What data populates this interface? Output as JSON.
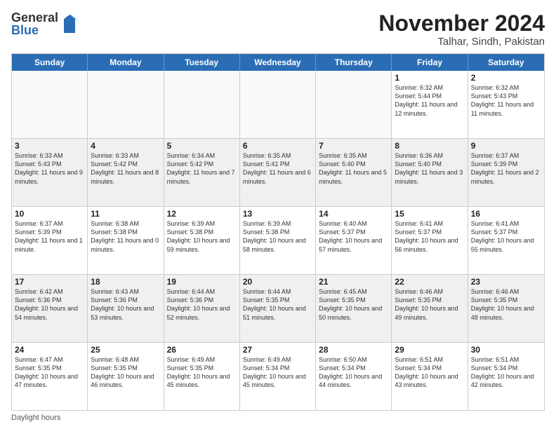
{
  "logo": {
    "general": "General",
    "blue": "Blue"
  },
  "title": {
    "month": "November 2024",
    "location": "Talhar, Sindh, Pakistan"
  },
  "header_days": [
    "Sunday",
    "Monday",
    "Tuesday",
    "Wednesday",
    "Thursday",
    "Friday",
    "Saturday"
  ],
  "weeks": [
    [
      {
        "day": "",
        "info": ""
      },
      {
        "day": "",
        "info": ""
      },
      {
        "day": "",
        "info": ""
      },
      {
        "day": "",
        "info": ""
      },
      {
        "day": "",
        "info": ""
      },
      {
        "day": "1",
        "info": "Sunrise: 6:32 AM\nSunset: 5:44 PM\nDaylight: 11 hours and 12 minutes."
      },
      {
        "day": "2",
        "info": "Sunrise: 6:32 AM\nSunset: 5:43 PM\nDaylight: 11 hours and 11 minutes."
      }
    ],
    [
      {
        "day": "3",
        "info": "Sunrise: 6:33 AM\nSunset: 5:43 PM\nDaylight: 11 hours and 9 minutes."
      },
      {
        "day": "4",
        "info": "Sunrise: 6:33 AM\nSunset: 5:42 PM\nDaylight: 11 hours and 8 minutes."
      },
      {
        "day": "5",
        "info": "Sunrise: 6:34 AM\nSunset: 5:42 PM\nDaylight: 11 hours and 7 minutes."
      },
      {
        "day": "6",
        "info": "Sunrise: 6:35 AM\nSunset: 5:41 PM\nDaylight: 11 hours and 6 minutes."
      },
      {
        "day": "7",
        "info": "Sunrise: 6:35 AM\nSunset: 5:40 PM\nDaylight: 11 hours and 5 minutes."
      },
      {
        "day": "8",
        "info": "Sunrise: 6:36 AM\nSunset: 5:40 PM\nDaylight: 11 hours and 3 minutes."
      },
      {
        "day": "9",
        "info": "Sunrise: 6:37 AM\nSunset: 5:39 PM\nDaylight: 11 hours and 2 minutes."
      }
    ],
    [
      {
        "day": "10",
        "info": "Sunrise: 6:37 AM\nSunset: 5:39 PM\nDaylight: 11 hours and 1 minute."
      },
      {
        "day": "11",
        "info": "Sunrise: 6:38 AM\nSunset: 5:38 PM\nDaylight: 11 hours and 0 minutes."
      },
      {
        "day": "12",
        "info": "Sunrise: 6:39 AM\nSunset: 5:38 PM\nDaylight: 10 hours and 59 minutes."
      },
      {
        "day": "13",
        "info": "Sunrise: 6:39 AM\nSunset: 5:38 PM\nDaylight: 10 hours and 58 minutes."
      },
      {
        "day": "14",
        "info": "Sunrise: 6:40 AM\nSunset: 5:37 PM\nDaylight: 10 hours and 57 minutes."
      },
      {
        "day": "15",
        "info": "Sunrise: 6:41 AM\nSunset: 5:37 PM\nDaylight: 10 hours and 56 minutes."
      },
      {
        "day": "16",
        "info": "Sunrise: 6:41 AM\nSunset: 5:37 PM\nDaylight: 10 hours and 55 minutes."
      }
    ],
    [
      {
        "day": "17",
        "info": "Sunrise: 6:42 AM\nSunset: 5:36 PM\nDaylight: 10 hours and 54 minutes."
      },
      {
        "day": "18",
        "info": "Sunrise: 6:43 AM\nSunset: 5:36 PM\nDaylight: 10 hours and 53 minutes."
      },
      {
        "day": "19",
        "info": "Sunrise: 6:44 AM\nSunset: 5:36 PM\nDaylight: 10 hours and 52 minutes."
      },
      {
        "day": "20",
        "info": "Sunrise: 6:44 AM\nSunset: 5:35 PM\nDaylight: 10 hours and 51 minutes."
      },
      {
        "day": "21",
        "info": "Sunrise: 6:45 AM\nSunset: 5:35 PM\nDaylight: 10 hours and 50 minutes."
      },
      {
        "day": "22",
        "info": "Sunrise: 6:46 AM\nSunset: 5:35 PM\nDaylight: 10 hours and 49 minutes."
      },
      {
        "day": "23",
        "info": "Sunrise: 6:46 AM\nSunset: 5:35 PM\nDaylight: 10 hours and 48 minutes."
      }
    ],
    [
      {
        "day": "24",
        "info": "Sunrise: 6:47 AM\nSunset: 5:35 PM\nDaylight: 10 hours and 47 minutes."
      },
      {
        "day": "25",
        "info": "Sunrise: 6:48 AM\nSunset: 5:35 PM\nDaylight: 10 hours and 46 minutes."
      },
      {
        "day": "26",
        "info": "Sunrise: 6:49 AM\nSunset: 5:35 PM\nDaylight: 10 hours and 45 minutes."
      },
      {
        "day": "27",
        "info": "Sunrise: 6:49 AM\nSunset: 5:34 PM\nDaylight: 10 hours and 45 minutes."
      },
      {
        "day": "28",
        "info": "Sunrise: 6:50 AM\nSunset: 5:34 PM\nDaylight: 10 hours and 44 minutes."
      },
      {
        "day": "29",
        "info": "Sunrise: 6:51 AM\nSunset: 5:34 PM\nDaylight: 10 hours and 43 minutes."
      },
      {
        "day": "30",
        "info": "Sunrise: 6:51 AM\nSunset: 5:34 PM\nDaylight: 10 hours and 42 minutes."
      }
    ]
  ],
  "footer": {
    "note": "Daylight hours"
  }
}
